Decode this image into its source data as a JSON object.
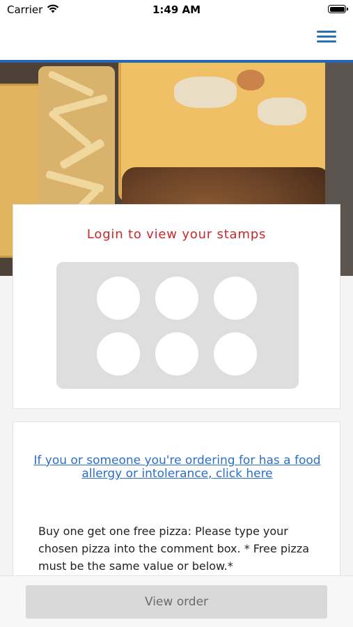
{
  "status_bar": {
    "carrier": "Carrier",
    "time": "1:49 AM",
    "wifi_icon": "wifi-icon",
    "battery_icon": "battery-icon"
  },
  "nav": {
    "menu_icon": "hamburger-menu-icon",
    "accent_color": "#2566b5"
  },
  "hero": {
    "image": "food-takeaway-photo"
  },
  "stamps": {
    "title": "Login to view your stamps",
    "title_color": "#c8282d",
    "count": 6
  },
  "info": {
    "allergy_link": "If you or someone you're ordering for has a food allergy or intolerance, click here",
    "promo_text": "Buy one get one free pizza: Please type your chosen pizza into the comment box. * Free pizza must be the same value or below.*"
  },
  "footer": {
    "view_order_label": "View order"
  }
}
